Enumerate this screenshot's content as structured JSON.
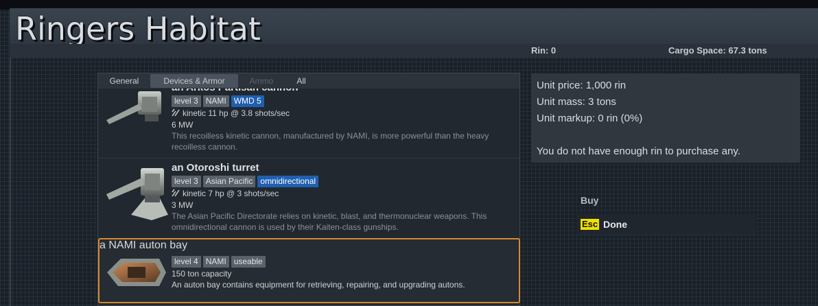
{
  "station": {
    "title": "Ringers Habitat"
  },
  "stats": {
    "rin_label": "Rin: 0",
    "cargo_label": "Cargo Space:  67.3 tons"
  },
  "tabs": [
    {
      "label": "General",
      "state": "normal"
    },
    {
      "label": "Devices & Armor",
      "state": "active"
    },
    {
      "label": "Ammo",
      "state": "disabled"
    },
    {
      "label": "All",
      "state": "normal"
    }
  ],
  "items": [
    {
      "name": "an Arkos Partisan cannon",
      "tags": [
        {
          "label": "level 3"
        },
        {
          "label": "NAMI"
        },
        {
          "label": "WMD 5",
          "style": "blue"
        }
      ],
      "damage": "kinetic 11 hp @ 3.8 shots/sec",
      "power": "6 MW",
      "description": "This recoilless kinetic cannon, manufactured by NAMI, is more powerful than the heavy recoilless cannon.",
      "icon": "cannon-turret-icon"
    },
    {
      "name": "an Otoroshi turret",
      "tags": [
        {
          "label": "level 3"
        },
        {
          "label": "Asian Pacific"
        },
        {
          "label": "omnidirectional",
          "style": "blue"
        }
      ],
      "damage": "kinetic 7 hp @ 3 shots/sec",
      "power": "3 MW",
      "description": "The Asian Pacific Directorate relies on kinetic, blast, and thermonuclear weapons. This omnidirectional cannon is used by their Kaiten-class gunships.",
      "icon": "otoroshi-turret-icon"
    },
    {
      "name": "a NAMI auton bay",
      "tags": [
        {
          "label": "level 4"
        },
        {
          "label": "NAMI"
        },
        {
          "label": "useable"
        }
      ],
      "capacity": "150 ton capacity",
      "description": "An auton bay contains equipment for retrieving, repairing, and upgrading autons.",
      "icon": "auton-bay-icon",
      "selected": true
    }
  ],
  "info": {
    "unit_price": "Unit price: 1,000 rin",
    "unit_mass": "Unit mass: 3 tons",
    "unit_markup": "Unit markup: 0 rin (0%)",
    "message": "You do not have enough rin to purchase any."
  },
  "actions": {
    "buy_label": "Buy",
    "done_key": "Esc",
    "done_label": "Done"
  },
  "colors": {
    "selection": "#d68a2e",
    "tag_blue": "#1f5fb0",
    "esc_key": "#f0e000"
  }
}
